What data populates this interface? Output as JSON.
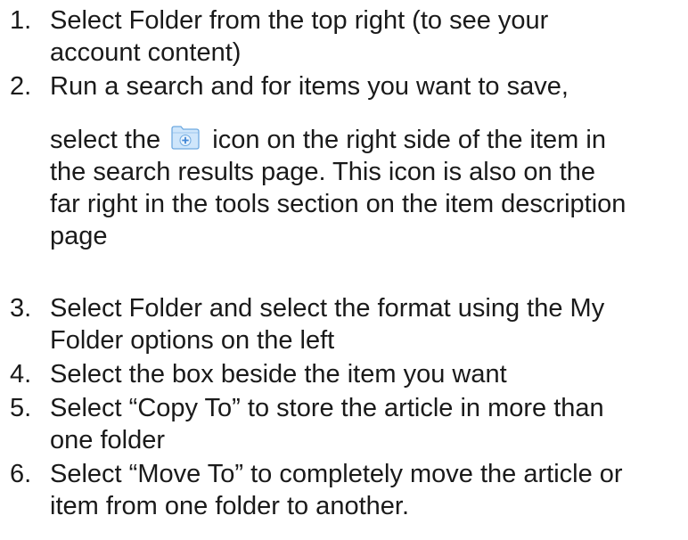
{
  "instructions": [
    {
      "number": "1.",
      "lines": [
        "Select Folder from the top right (to see your",
        "account content)"
      ]
    },
    {
      "number": "2.",
      "lines": [
        "Run a search and for items you want to save,"
      ],
      "icon_line": {
        "before": "select the",
        "after": "icon on the right side of the item in",
        "icon": "folder-plus-icon"
      },
      "more_lines": [
        "the search results page. This icon is also on the",
        "far right in the tools section on the item description",
        "page"
      ]
    },
    {
      "number": "3.",
      "lines": [
        "Select Folder and select the format using the My",
        "Folder options on the left"
      ]
    },
    {
      "number": "4.",
      "lines": [
        "Select the box beside the item you want"
      ]
    },
    {
      "number": "5.",
      "lines": [
        "Select “Copy To” to store the article in more than",
        "one folder"
      ]
    },
    {
      "number": "6.",
      "lines": [
        "Select “Move To” to completely move the article or",
        "item from one folder to another."
      ]
    }
  ],
  "colors": {
    "text": "#1a1a1a",
    "icon_fill": "#cfe6fb",
    "icon_stroke": "#6ea9e0",
    "icon_plus": "#3f86d6"
  }
}
